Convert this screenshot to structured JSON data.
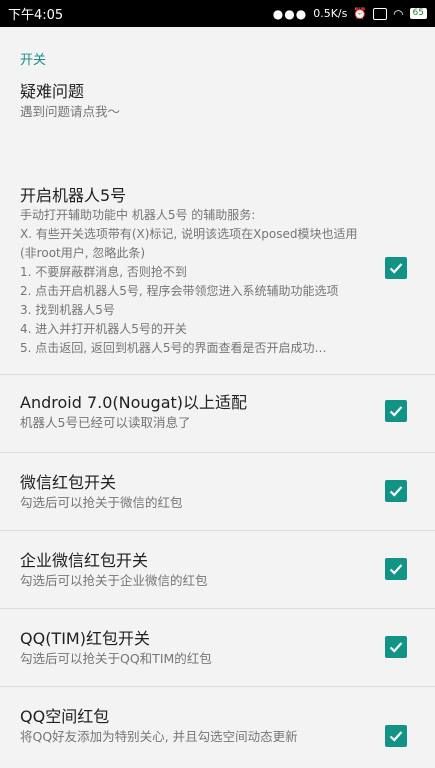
{
  "status_bar": {
    "time": "下午4:05",
    "network_speed": "0.5K/s",
    "battery": "65"
  },
  "section": {
    "title": "开关"
  },
  "troubleshoot": {
    "title": "疑难问题",
    "summary": "遇到问题请点我～"
  },
  "prefs": [
    {
      "title": "开启机器人5号",
      "summary": "手动打开辅助功能中 机器人5号 的辅助服务:\n X. 有些开关选项带有(X)标记, 说明该选项在Xposed模块也适用(非root用户, 忽略此条)\n 1. 不要屏蔽群消息, 否则抢不到\n 2. 点击开启机器人5号, 程序会带领您进入系统辅助功能选项\n 3. 找到机器人5号\n 4. 进入并打开机器人5号的开关\n 5. 点击返回, 返回到机器人5号的界面查看是否开启成功…",
      "checked": true
    },
    {
      "title": "Android 7.0(Nougat)以上适配",
      "summary": "机器人5号已经可以读取消息了",
      "checked": true
    },
    {
      "title": "微信红包开关",
      "summary": "勾选后可以抢关于微信的红包",
      "checked": true
    },
    {
      "title": "企业微信红包开关",
      "summary": "勾选后可以抢关于企业微信的红包",
      "checked": true
    },
    {
      "title": "QQ(TIM)红包开关",
      "summary": "勾选后可以抢关于QQ和TIM的红包",
      "checked": true
    },
    {
      "title": "QQ空间红包",
      "summary": "将QQ好友添加为特别关心, 并且勾选空间动态更新",
      "checked": true
    }
  ],
  "colors": {
    "accent": "#119385",
    "section_header": "#1a8c8c"
  }
}
